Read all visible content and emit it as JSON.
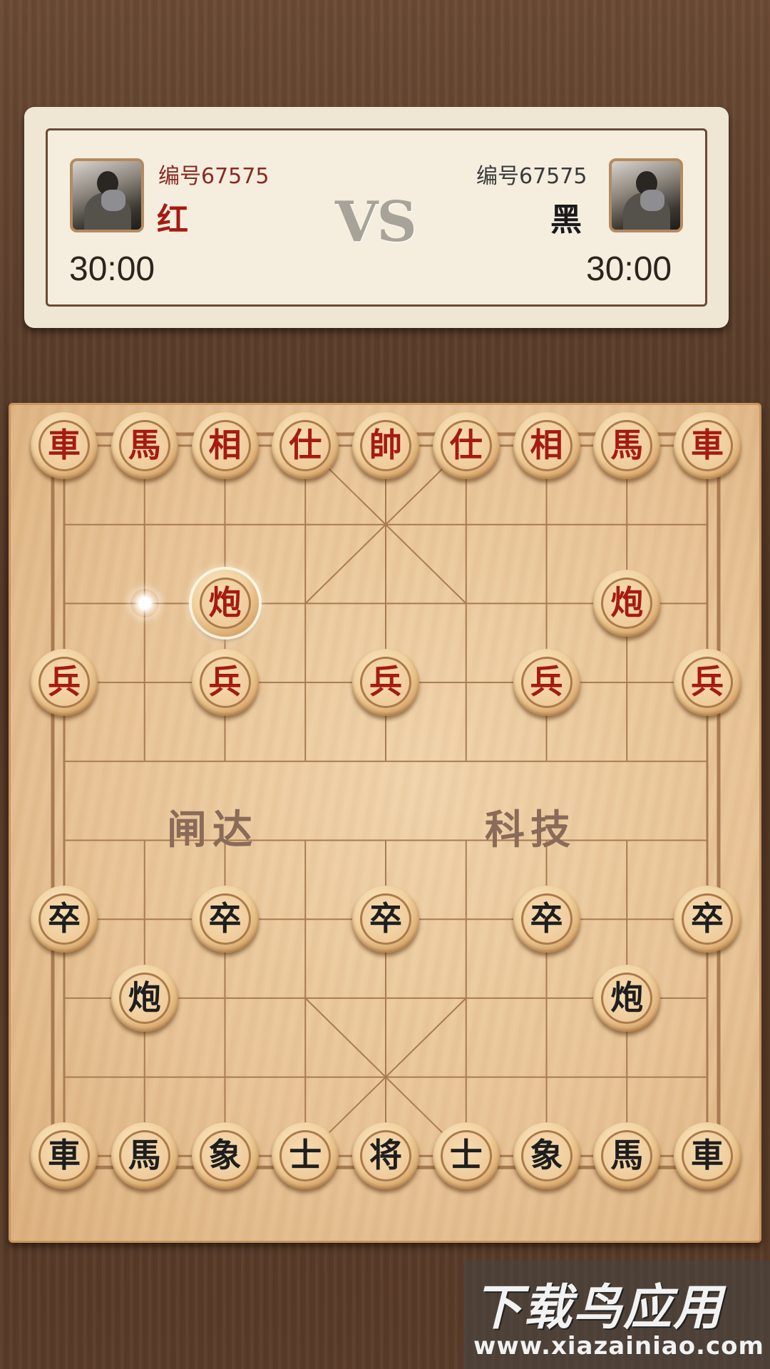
{
  "header": {
    "left_player": {
      "id_label": "编号67575",
      "side_label": "红",
      "clock": "30:00"
    },
    "versus_label": "VS",
    "right_player": {
      "id_label": "编号67575",
      "side_label": "黑",
      "clock": "30:00"
    }
  },
  "board": {
    "river_left": "闸达",
    "river_right": "科技",
    "colors": {
      "red_piece_text": "#a51b12",
      "black_piece_text": "#1e1e1e",
      "line": "#a97b52"
    },
    "selected_piece": {
      "col": 2,
      "row": 2
    },
    "move_hint": {
      "col": 1,
      "row": 2
    },
    "pieces": [
      {
        "side": "red",
        "char": "車",
        "col": 0,
        "row": 0
      },
      {
        "side": "red",
        "char": "馬",
        "col": 1,
        "row": 0
      },
      {
        "side": "red",
        "char": "相",
        "col": 2,
        "row": 0
      },
      {
        "side": "red",
        "char": "仕",
        "col": 3,
        "row": 0
      },
      {
        "side": "red",
        "char": "帥",
        "col": 4,
        "row": 0
      },
      {
        "side": "red",
        "char": "仕",
        "col": 5,
        "row": 0
      },
      {
        "side": "red",
        "char": "相",
        "col": 6,
        "row": 0
      },
      {
        "side": "red",
        "char": "馬",
        "col": 7,
        "row": 0
      },
      {
        "side": "red",
        "char": "車",
        "col": 8,
        "row": 0
      },
      {
        "side": "red",
        "char": "炮",
        "col": 2,
        "row": 2
      },
      {
        "side": "red",
        "char": "炮",
        "col": 7,
        "row": 2
      },
      {
        "side": "red",
        "char": "兵",
        "col": 0,
        "row": 3
      },
      {
        "side": "red",
        "char": "兵",
        "col": 2,
        "row": 3
      },
      {
        "side": "red",
        "char": "兵",
        "col": 4,
        "row": 3
      },
      {
        "side": "red",
        "char": "兵",
        "col": 6,
        "row": 3
      },
      {
        "side": "red",
        "char": "兵",
        "col": 8,
        "row": 3
      },
      {
        "side": "black",
        "char": "卒",
        "col": 0,
        "row": 6
      },
      {
        "side": "black",
        "char": "卒",
        "col": 2,
        "row": 6
      },
      {
        "side": "black",
        "char": "卒",
        "col": 4,
        "row": 6
      },
      {
        "side": "black",
        "char": "卒",
        "col": 6,
        "row": 6
      },
      {
        "side": "black",
        "char": "卒",
        "col": 8,
        "row": 6
      },
      {
        "side": "black",
        "char": "炮",
        "col": 1,
        "row": 7
      },
      {
        "side": "black",
        "char": "炮",
        "col": 7,
        "row": 7
      },
      {
        "side": "black",
        "char": "車",
        "col": 0,
        "row": 9
      },
      {
        "side": "black",
        "char": "馬",
        "col": 1,
        "row": 9
      },
      {
        "side": "black",
        "char": "象",
        "col": 2,
        "row": 9
      },
      {
        "side": "black",
        "char": "士",
        "col": 3,
        "row": 9
      },
      {
        "side": "black",
        "char": "将",
        "col": 4,
        "row": 9
      },
      {
        "side": "black",
        "char": "士",
        "col": 5,
        "row": 9
      },
      {
        "side": "black",
        "char": "象",
        "col": 6,
        "row": 9
      },
      {
        "side": "black",
        "char": "馬",
        "col": 7,
        "row": 9
      },
      {
        "side": "black",
        "char": "車",
        "col": 8,
        "row": 9
      }
    ]
  },
  "watermark": {
    "title": "下载鸟应用",
    "url": "www.xiazainiao.com"
  }
}
